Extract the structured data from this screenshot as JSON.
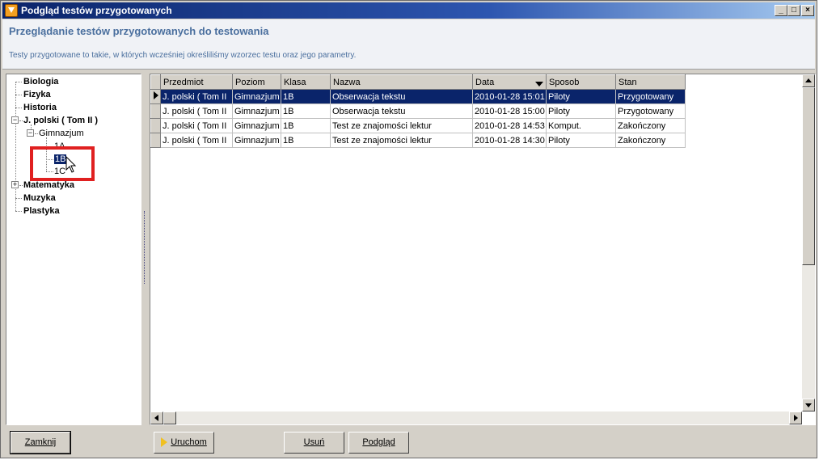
{
  "window": {
    "title": "Podgląd testów przygotowanych",
    "controls": {
      "minimize": "_",
      "maximize": "□",
      "close": "×"
    }
  },
  "header": {
    "heading": "Przeglądanie testów przygotowanych do testowania",
    "description": "Testy przygotowane to takie, w których wcześniej określiliśmy wzorzec testu oraz jego parametry."
  },
  "tree": {
    "subjects": [
      "Biologia",
      "Fizyka",
      "Historia",
      "J. polski   ( Tom II )",
      "Matematyka",
      "Muzyka",
      "Plastyka"
    ],
    "level": "Gimnazjum",
    "classes": [
      "1A",
      "1B",
      "1C"
    ],
    "expander_open": "−",
    "expander_closed": "+",
    "selected": "1B"
  },
  "grid": {
    "columns": [
      "Przedmiot",
      "Poziom",
      "Klasa",
      "Nazwa",
      "Data",
      "Sposob",
      "Stan"
    ],
    "sorted_column": "Data",
    "rows": [
      [
        "J. polski   ( Tom II",
        "Gimnazjum",
        "1B",
        "Obserwacja tekstu",
        "2010-01-28 15:01",
        "Piloty",
        "Przygotowany"
      ],
      [
        "J. polski   ( Tom II",
        "Gimnazjum",
        "1B",
        "Obserwacja tekstu",
        "2010-01-28 15:00",
        "Piloty",
        "Przygotowany"
      ],
      [
        "J. polski   ( Tom II",
        "Gimnazjum",
        "1B",
        "Test ze znajomości lektur",
        "2010-01-28 14:53",
        "Komput.",
        "Zakończony"
      ],
      [
        "J. polski   ( Tom II",
        "Gimnazjum",
        "1B",
        "Test ze znajomości lektur",
        "2010-01-28 14:30",
        "Piloty",
        "Zakończony"
      ]
    ],
    "selected_row": 0
  },
  "buttons": {
    "close": "Zamknij",
    "run": "Uruchom",
    "delete": "Usuń",
    "preview": "Podgląd"
  },
  "colors": {
    "selection": "#0a246a",
    "highlight": "#e02020",
    "header_text": "#4a6f9e"
  }
}
